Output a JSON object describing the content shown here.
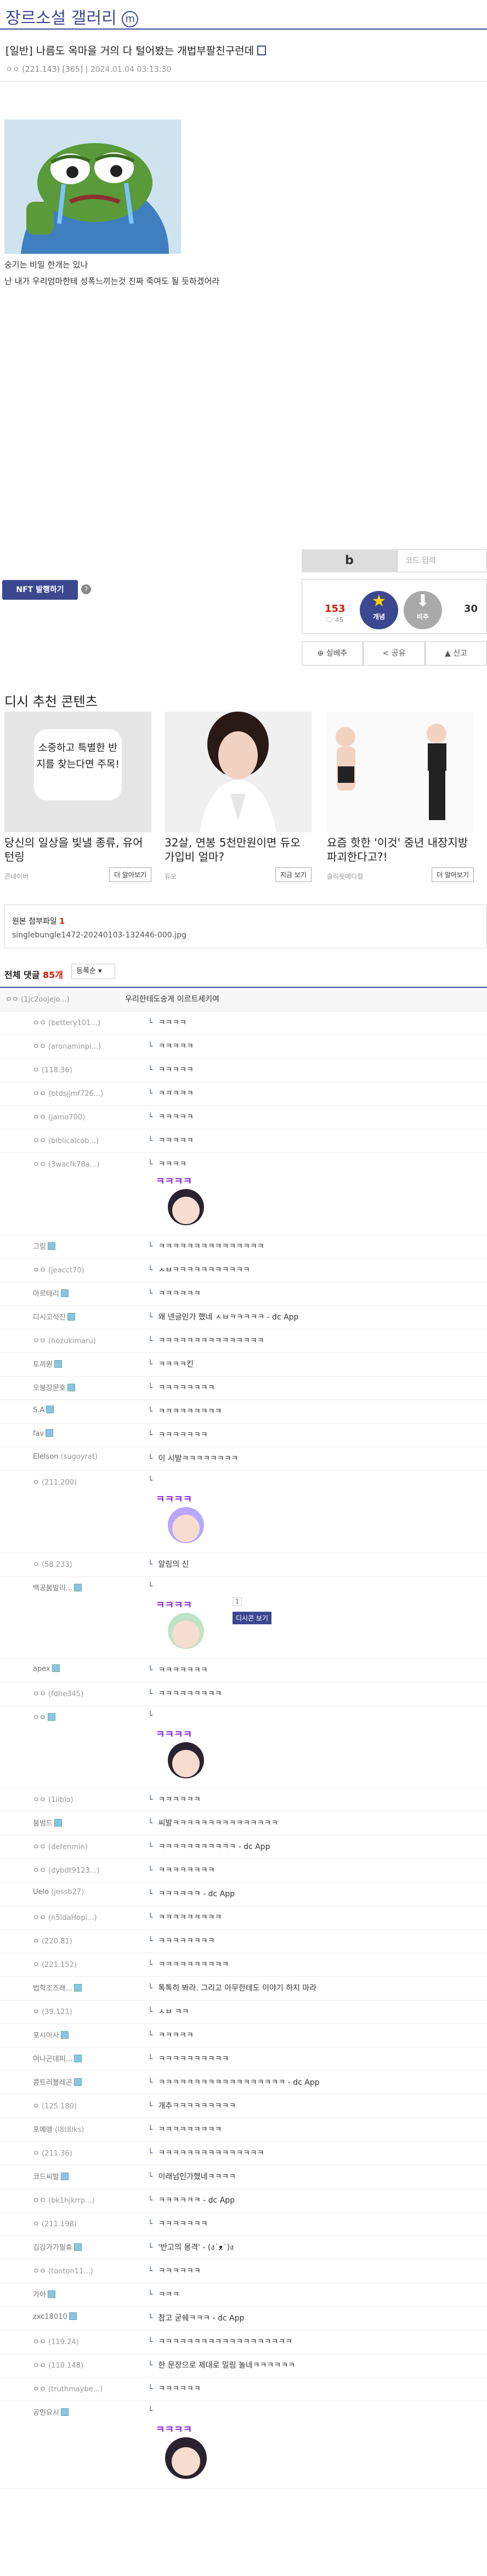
{
  "gallery": {
    "title": "장르소설 갤러리",
    "mark": "m"
  },
  "post": {
    "title": "[일반] 나름도 옥마을 거의 다 털어봤는 개법부팔친구런데",
    "author": "ㅇㅇ",
    "ip": "(221.143)",
    "sub": "[365]",
    "date": "2024.01.04 03:13:30",
    "lines": [
      "숭기는 비밀 한개는 있나",
      "난 내가 우리엄마한테 성폭느끼는것 진짜 죽여도 될 듯하겠어라"
    ]
  },
  "nft": {
    "label": "NFT 발행하기",
    "help": "?"
  },
  "vote": {
    "b": "b",
    "code_placeholder": "코드 입력",
    "up_count": "153",
    "up_sub": "🗨 45",
    "up_label": "개념",
    "down_label": "비추",
    "down_count": "30",
    "share_count": "실베추",
    "share_label": "공유",
    "report_label": "신고"
  },
  "recommend": {
    "title": "디시 추천 콘텐츠",
    "cards": [
      {
        "img_text": "소중하고 특별한 반지를 찾는다면 주목!",
        "title": "당신의 일상을 빛낼 종류, 유어 턴링",
        "src": "콘네이버",
        "btn": "더 알아보기"
      },
      {
        "img_text": "",
        "title": "32살, 연봉 5천만원이면 듀오 가입비 얼마?",
        "src": "듀오",
        "btn": "지금 보기"
      },
      {
        "img_text": "",
        "title": "요즘 핫한 '이것' 중년 내장지방 파괴한다고?!",
        "src": "슬릭핏메디컬",
        "btn": "더 알아보기"
      }
    ]
  },
  "attach": {
    "title": "원본 첨부파일",
    "count": "1",
    "file": "singlebungle1472-20240103-132446-000.jpg"
  },
  "comments": {
    "header": "전체 댓글",
    "count": "85개",
    "sort": "등록순",
    "items": [
      {
        "nick": "ㅇㅇ",
        "ip": "(1jc2oojejo...)",
        "text": "우리한테도숭게 이르트세키여"
      },
      {
        "nick": "ㅇㅇ",
        "ip": "(bettery101...)",
        "text": "ㅋㅋㅋㅋ"
      },
      {
        "nick": "ㅇㅇ",
        "ip": "(aronaminpi...)",
        "text": "ㅋㅋㅋㅋㅋ"
      },
      {
        "nick": "ㅇ",
        "ip": "(118.36)",
        "text": "ㅋㅋㅋㅋㅋ"
      },
      {
        "nick": "ㅇㅇ",
        "ip": "(btdsjjmf726...)",
        "text": "ㅋㅋㅋㅋㅋ"
      },
      {
        "nick": "ㅇㅇ",
        "ip": "(jamo700)",
        "text": "ㅋㅋㅋㅋㅋ"
      },
      {
        "nick": "ㅇㅇ",
        "ip": "(biblicalcob...)",
        "text": "ㅋㅋㅋㅋㅋ"
      },
      {
        "nick": "ㅇㅇ",
        "ip": "(3wacfk78a...)",
        "text": "ㅋㅋㅋㅋ"
      },
      {
        "nick": "그림",
        "ip": "",
        "text": "ㅋㅋㅋㅋㅋㅋㅋㅋㅋㅋㅋㅋㅋㅋㅋ"
      },
      {
        "nick": "ㅇㅇ",
        "ip": "(jeacct70)",
        "text": "ㅅㅂㅋㅋㅋㅋㅋㅋㅋㅋㅋㅋㅋ"
      },
      {
        "nick": "아르테리",
        "ip": "",
        "text": "ㅋㅋㅋㅋㅋㅋ"
      },
      {
        "nick": "디시고석진",
        "ip": "",
        "text": "왜 넨글인가 했네 ㅅㅂㅋㅋㅋㅋㅋ - dc App"
      },
      {
        "nick": "ㅇㅇ",
        "ip": "(hozukimaru)",
        "text": "ㅋㅋㅋㅋㅋㅋㅋㅋㅋㅋㅋㅋㅋㅋㅋ"
      },
      {
        "nick": "토끼원",
        "ip": "",
        "text": "ㅋㅋㅋㅋ킨"
      },
      {
        "nick": "오붕장문호",
        "ip": "",
        "text": "ㅋㅋㅋㅋㅋㅋㅋㅋ"
      },
      {
        "nick": "S.A",
        "ip": "",
        "text": "ㅋㅋㅋㅋㅋㅋㅋㅋㅋ"
      },
      {
        "nick": "fav",
        "ip": "",
        "text": "ㅋㅋㅋㅋㅋㅋㅋ"
      },
      {
        "nick": "Elelson",
        "ip": "(sugoyrat)",
        "text": "이 시발ㅋㅋㅋㅋㅋㅋㅋㅋ"
      },
      {
        "nick": "ㅇ",
        "ip": "(211.200)",
        "text": ""
      },
      {
        "nick": "ㅇ",
        "ip": "(58.233)",
        "text": "알림의 신"
      },
      {
        "nick": "백공붐발리...",
        "ip": "",
        "text": ""
      },
      {
        "nick": "apex",
        "ip": "",
        "text": "ㅋㅋㅋㅋㅋㅋㅋ"
      },
      {
        "nick": "ㅇㅇ",
        "ip": "(fdhe345)",
        "text": "ㅋㅋㅋㅋㅋㅋㅋㅋㅋ"
      },
      {
        "nick": "ㅇㅇ",
        "ip": "",
        "text": ""
      },
      {
        "nick": "ㅇㅇ",
        "ip": "(1iiblo)",
        "text": "ㅋㅋㅋㅋㅋㅋ"
      },
      {
        "nick": "붐범드",
        "ip": "",
        "text": "씨발ㅋㅋㅋㅋㅋㅋㅋㅋㅋㅋㅋㅋㅋㅋㅋ"
      },
      {
        "nick": "ㅇㅇ",
        "ip": "(defenmin)",
        "text": "ㅋㅋㅋㅋㅋㅋㅋㅋㅋㅋㅋ - dc App"
      },
      {
        "nick": "ㅇㅇ",
        "ip": "(dybdt9123...)",
        "text": "ㅋㅋㅋㅋㅋㅋㅋㅋ"
      },
      {
        "nick": "Uelo",
        "ip": "(jessb27)",
        "text": "ㅋㅋㅋㅋㅋㅋ - dc App"
      },
      {
        "nick": "ㅇㅇ",
        "ip": "(n5ldaHopi...)",
        "text": "ㅋㅋㅋㅋㅋㅋㅋㅋㅋ"
      },
      {
        "nick": "ㅇ",
        "ip": "(220.81)",
        "text": "ㅋㅋㅋㅋㅋㅋㅋㅋ"
      },
      {
        "nick": "ㅇ",
        "ip": "(221.152)",
        "text": "ㅋㅋㅋㅋㅋㅋㅋㅋㅋㅋ"
      },
      {
        "nick": "법학조즈래...",
        "ip": "",
        "text": "톡톡히 봐라. 그리고 아무한테도 이야기 하지 마라"
      },
      {
        "nick": "ㅇ",
        "ip": "(39.121)",
        "text": "ㅅㅂ ㅋㅋ"
      },
      {
        "nick": "포시아사",
        "ip": "",
        "text": "ㅋㅋㅋㅋㅋ"
      },
      {
        "nick": "머나곤데피...",
        "ip": "",
        "text": "ㅋㅋㅋㅋㅋㅋㅋㅋㅋㅋ"
      },
      {
        "nick": "콩트러블레곤",
        "ip": "",
        "text": "ㅋㅋㅋㅋㅋㅋㅋㅋㅋㅋㅋㅋㅋㅋㅋㅋㅋㅋ - dc App"
      },
      {
        "nick": "ㅇ",
        "ip": "(125.180)",
        "text": "개추ㅋㅋㅋㅋㅋㅋㅋㅋㅋ"
      },
      {
        "nick": "포예엥",
        "ip": "(l8t8lks)",
        "text": "ㅋㅋㅋㅋㅋㅋㅋㅋㅋ"
      },
      {
        "nick": "ㅇ",
        "ip": "(211.36)",
        "text": "ㅋㅋㅋㅋㅋㅋㅋㅋㅋㅋㅋㅋㅋㅋㅋ"
      },
      {
        "nick": "코드씨발",
        "ip": "",
        "text": "이래넘인가했네ㅋㅋㅋㅋ"
      },
      {
        "nick": "ㅇㅇ",
        "ip": "(bk1hjkrrp...)",
        "text": "ㅋㅋㅋㅋㅋㅋ - dc App"
      },
      {
        "nick": "ㅇ",
        "ip": "(211.198)",
        "text": "ㅋㅋㅋㅋㅋㅋㅋ"
      },
      {
        "nick": "김강가가필휴",
        "ip": "",
        "text": "'반고의 몽격' - (ง˙ᴥ˙)ง"
      },
      {
        "nick": "ㅇㅇ",
        "ip": "(tonton11...)",
        "text": "ㅋㅋㅋㅋㅋㅋ"
      },
      {
        "nick": "가아",
        "ip": "",
        "text": "ㅋㅋㅋ"
      },
      {
        "nick": "zxc18010",
        "ip": "",
        "text": "참고 굳쉐ㅋㅋㅋ - dc App"
      },
      {
        "nick": "ㅇㅇ",
        "ip": "(119.24)",
        "text": "ㅋㅋㅋㅋㅋㅋㅋㅋㅋㅋㅋㅋㅋㅋㅋㅋㅋㅋㅋ"
      },
      {
        "nick": "ㅇㅇ",
        "ip": "(110.148)",
        "text": "한 문장으로 제대로 밀림 놀네ㅋㅋㅋㅋㅋㅋ"
      },
      {
        "nick": "ㅇㅇ",
        "ip": "(truthmaybe...)",
        "text": "ㅋㅋㅋㅋㅋㅋ"
      },
      {
        "nick": "공인요시",
        "ip": "",
        "text": ""
      }
    ]
  },
  "dccon": {
    "kkk": "ㅋㅋㅋㅋ",
    "orig": "디시콘 보기",
    "one": "1"
  }
}
